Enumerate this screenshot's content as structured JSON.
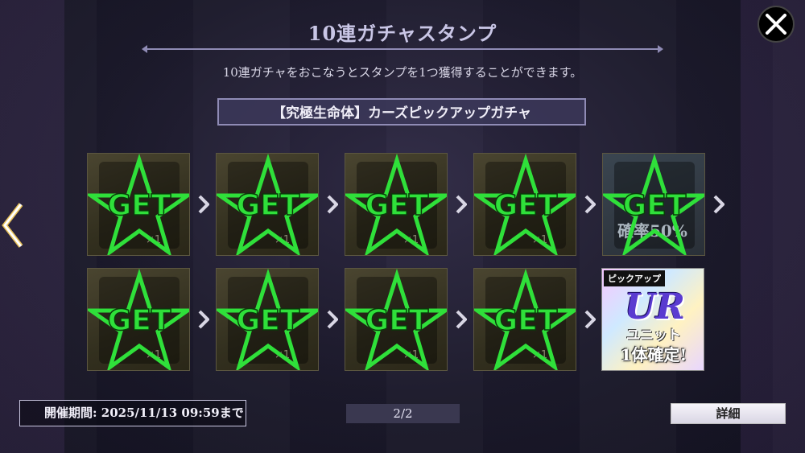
{
  "header": {
    "title": "10連ガチャスタンプ",
    "subtitle": "10連ガチャをおこなうとスタンプを1つ獲得することができます。",
    "banner": "【究極生命体】カーズピックアップガチャ"
  },
  "stamps": {
    "get_label": "GET",
    "qty_label": "×1",
    "fifth_stamp_text": "確率50%"
  },
  "reward": {
    "tag": "ピックアップ",
    "rarity": "UR",
    "line1": "ユニット",
    "line2": "1体確定!"
  },
  "footer": {
    "period": "開催期間: 2025/11/13 09:59まで",
    "page": "2/2",
    "details_button": "詳細"
  },
  "colors": {
    "get_green": "#2fe03a",
    "accent_lavender": "#8f8bb5"
  }
}
